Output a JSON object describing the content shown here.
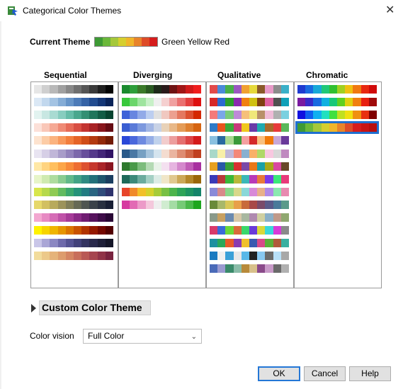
{
  "window": {
    "title": "Categorical Color Themes",
    "close_icon": "close-icon",
    "app_icon": "jmp-app-icon"
  },
  "current_theme": {
    "label": "Current Theme",
    "name": "Green Yellow Red",
    "colors": [
      "#3e9a35",
      "#6bb83a",
      "#a5c83a",
      "#d6cf2e",
      "#f0b52a",
      "#e8842a",
      "#de4b27",
      "#d61c1c"
    ]
  },
  "columns": [
    {
      "label": "Sequential",
      "themes": [
        [
          "#e6e6e6",
          "#cfcfcf",
          "#b8b8b8",
          "#a0a0a0",
          "#888888",
          "#6f6f6f",
          "#555555",
          "#3a3a3a",
          "#1f1f1f",
          "#050505"
        ],
        [
          "#dbe8f5",
          "#c2d8ee",
          "#a3c3e3",
          "#84acd6",
          "#6694c8",
          "#4c7bb8",
          "#3563a6",
          "#224c90",
          "#143777",
          "#0a2358"
        ],
        [
          "#e2f3f0",
          "#c8e7e2",
          "#a9dbd2",
          "#87cdbf",
          "#66bca8",
          "#4aa78e",
          "#338f73",
          "#20755b",
          "#125c45",
          "#074430"
        ],
        [
          "#fce0d8",
          "#f9c7b8",
          "#f5a995",
          "#ef8a75",
          "#e66b58",
          "#d84e42",
          "#c33431",
          "#a82225",
          "#88151c",
          "#650b13"
        ],
        [
          "#fde3cf",
          "#fccca6",
          "#fbb37f",
          "#f8995c",
          "#f27e3d",
          "#e56427",
          "#d04d18",
          "#b33a10",
          "#932a0a",
          "#721c05"
        ],
        [
          "#e8e4f1",
          "#d6cfe6",
          "#c0b6d8",
          "#a89cc9",
          "#9282bb",
          "#7c68ab",
          "#684f9b",
          "#55398a",
          "#432578",
          "#311364"
        ],
        [
          "#ffe8a6",
          "#ffd480",
          "#ffbf5e",
          "#fca548",
          "#f78a3a",
          "#ee6d32",
          "#dd5130",
          "#c6372d",
          "#aa2428",
          "#8a1520"
        ],
        [
          "#e7f5c8",
          "#cfeab0",
          "#aedc9e",
          "#89cc91",
          "#62b98a",
          "#43a386",
          "#2f8a82",
          "#22707a",
          "#1e566e",
          "#1a3e60"
        ],
        [
          "#d8e64c",
          "#b6d94c",
          "#8fcb54",
          "#62bb60",
          "#3ca86d",
          "#26937a",
          "#227c82",
          "#296582",
          "#2f4c7b",
          "#2e336c"
        ],
        [
          "#e6d86a",
          "#d2c060",
          "#b8aa5c",
          "#9c935a",
          "#807e58",
          "#666955",
          "#4f5551",
          "#3a424a",
          "#283040",
          "#181f34"
        ],
        [
          "#f3a8d0",
          "#e78ac3",
          "#d56cb6",
          "#bf52a8",
          "#a63b98",
          "#8b2a86",
          "#701d72",
          "#56135d",
          "#3e0c48",
          "#290634"
        ],
        [
          "#fff200",
          "#f7d400",
          "#efb500",
          "#e69500",
          "#da7400",
          "#c95300",
          "#b23400",
          "#951900",
          "#740800",
          "#520000"
        ],
        [
          "#c9c6e8",
          "#aaa6d6",
          "#8b87c2",
          "#6e6aab",
          "#555393",
          "#42417a",
          "#343461",
          "#29294b",
          "#1e1f38",
          "#141527"
        ],
        [
          "#f2dc9c",
          "#ecc98a",
          "#e5b37a",
          "#dd9c6d",
          "#d48563",
          "#c86e5b",
          "#b95955",
          "#a6454f",
          "#903348",
          "#78233f"
        ]
      ]
    },
    {
      "label": "Diverging",
      "themes": [
        [
          "#1a8a2e",
          "#2e9e3a",
          "#3b7a2a",
          "#2a5a22",
          "#1e2a1a",
          "#2a1a1a",
          "#6e1212",
          "#a01616",
          "#d01a1a",
          "#f01e1e"
        ],
        [
          "#38c83c",
          "#6ad66a",
          "#9ee49e",
          "#c8f0c8",
          "#efefef",
          "#f5d0d0",
          "#f0a0a0",
          "#ea7070",
          "#e44040",
          "#de1010"
        ],
        [
          "#3e62d8",
          "#6886e0",
          "#92aae8",
          "#bccef0",
          "#e0e0e0",
          "#f0c8c0",
          "#eca090",
          "#e47860",
          "#dc5030",
          "#d42800"
        ],
        [
          "#3a5ed2",
          "#5a7ad8",
          "#7c98de",
          "#a2b6e4",
          "#c8d2e6",
          "#e8d2b8",
          "#e8b888",
          "#e49c58",
          "#de8030",
          "#d66410"
        ],
        [
          "#2a48d8",
          "#4a68dc",
          "#6e8ae0",
          "#96aee6",
          "#c0d2ec",
          "#f2cccc",
          "#ec9e9e",
          "#e47070",
          "#dc4444",
          "#d41a1a"
        ],
        [
          "#2a5a8a",
          "#4a78a4",
          "#76a0c2",
          "#a6c4dc",
          "#d4e4ee",
          "#f4dcd0",
          "#eab4a0",
          "#de8c72",
          "#d06646",
          "#c04020"
        ],
        [
          "#2e7a2e",
          "#4a9a4a",
          "#7cbc7c",
          "#b4dab4",
          "#e8f2e8",
          "#f4e0f0",
          "#e6b4e0",
          "#d488cc",
          "#c05cb6",
          "#a830a0"
        ],
        [
          "#1e6a5a",
          "#3c8a7a",
          "#6cac9e",
          "#a4d0c4",
          "#dcece6",
          "#f0e6c8",
          "#e0c890",
          "#cca858",
          "#b48628",
          "#9a6608"
        ],
        [
          "#e7452a",
          "#f08a2a",
          "#f2c02a",
          "#d4d22e",
          "#a6cc3a",
          "#78c044",
          "#4cb44c",
          "#2ea458",
          "#1e9462",
          "#14846a"
        ],
        [
          "#d63aa0",
          "#e26ab4",
          "#ec9ac8",
          "#f4c8dc",
          "#eeeeee",
          "#d0ecd0",
          "#a4dca4",
          "#76ca76",
          "#4ab84a",
          "#1ea61e"
        ]
      ]
    },
    {
      "label": "Qualitative",
      "themes": [
        [
          "#e24a4a",
          "#4a8ad8",
          "#48b048",
          "#9a58c0",
          "#f0a030",
          "#e6d83a",
          "#8a5a2a",
          "#e89ac8",
          "#8c8c8c",
          "#3ab0c8"
        ],
        [
          "#d62828",
          "#2a6ad0",
          "#2aa02a",
          "#8a2ab0",
          "#f08010",
          "#d0c010",
          "#804010",
          "#e060a0",
          "#505050",
          "#10a0b8"
        ],
        [
          "#f47a7a",
          "#7aa6e8",
          "#7acc7a",
          "#be8ad8",
          "#f6c07a",
          "#f0e87a",
          "#b8906a",
          "#f0bcd8",
          "#b0b0b0",
          "#7ad0e0"
        ],
        [
          "#2e7ac8",
          "#e8541e",
          "#3aaa3a",
          "#c83a7a",
          "#f0c81e",
          "#6a3aa8",
          "#1eaab0",
          "#a86a2a",
          "#e83a3a",
          "#5ab85a"
        ],
        [
          "#8ac0e0",
          "#2a6aa0",
          "#a8d890",
          "#3a9a3a",
          "#f4a0a0",
          "#d42a2a",
          "#f8c080",
          "#f07a0a",
          "#c8a8d8",
          "#6a3a9a"
        ],
        [
          "#a8d8c8",
          "#f8f0a8",
          "#c0b8d8",
          "#f48878",
          "#88b0d0",
          "#f8b068",
          "#b0d868",
          "#f8c8e0",
          "#d8d8d8",
          "#c08ac0"
        ],
        [
          "#e6a020",
          "#2a58a8",
          "#38a038",
          "#d83030",
          "#7a48a8",
          "#e87818",
          "#18a0a8",
          "#a8a818",
          "#d848a0",
          "#684828"
        ],
        [
          "#3a3ab8",
          "#b83a3a",
          "#3ab83a",
          "#b8b83a",
          "#3ab8b8",
          "#b83ab8",
          "#e87a3a",
          "#7a3ae8",
          "#3ae87a",
          "#e83a7a"
        ],
        [
          "#8a8ad8",
          "#d88a8a",
          "#8ad88a",
          "#d8d88a",
          "#8ad8d8",
          "#d88ad8",
          "#e8b08a",
          "#b08ae8",
          "#8ae8b0",
          "#e88ab0"
        ],
        [
          "#6a8a3a",
          "#a8b86a",
          "#d8c858",
          "#e8a04a",
          "#c86a3a",
          "#a84848",
          "#7a4a6a",
          "#5a5a8a",
          "#4a7a9a",
          "#5a9a8a"
        ],
        [
          "#8a9a8a",
          "#c8a060",
          "#6a8ab0",
          "#d8c8a8",
          "#a8b8a0",
          "#b08ab0",
          "#d0d0a0",
          "#8ab0c8",
          "#c09a8a",
          "#90a870"
        ],
        [
          "#d83a6a",
          "#3a6ad8",
          "#6ad83a",
          "#d86a3a",
          "#3ad86a",
          "#6a3ad8",
          "#d8d83a",
          "#3ad8d8",
          "#d83ad8",
          "#8a8a8a"
        ],
        [
          "#1e90a0",
          "#2aa85a",
          "#e85a2a",
          "#8a3ab0",
          "#f0c02a",
          "#3a5ab0",
          "#d84a8a",
          "#5ab03a",
          "#b05a3a",
          "#3ab0a0"
        ],
        [
          "#1a7ac0",
          "#f0f0f0",
          "#3aa0d8",
          "#e8e8e8",
          "#58b8e8",
          "#202020",
          "#88c8f0",
          "#6a6a6a",
          "#b8e0f8",
          "#a8a8a8"
        ],
        [
          "#4a6ab8",
          "#9a9ad0",
          "#3a8a6a",
          "#8abca8",
          "#b88a3a",
          "#d8c08a",
          "#8a4a8a",
          "#c89ac8",
          "#6a6a6a",
          "#b0b0b0"
        ]
      ]
    },
    {
      "label": "Chromatic",
      "themes": [
        [
          "#1e3ad0",
          "#1a6ae0",
          "#18a8d8",
          "#20c878",
          "#30c030",
          "#a0d020",
          "#f0c010",
          "#f07810",
          "#e82810",
          "#d00a0a"
        ],
        [
          "#7a1aa0",
          "#3a2ac8",
          "#1a6ae0",
          "#10b0e0",
          "#18c878",
          "#60d020",
          "#e0d010",
          "#f08010",
          "#e82010",
          "#a00a0a"
        ],
        [
          "#1010e0",
          "#1060f0",
          "#10b0f0",
          "#20e0c0",
          "#40e040",
          "#c0e020",
          "#f0e010",
          "#f09010",
          "#e83010",
          "#800000"
        ],
        [
          "#3e9a35",
          "#6bb83a",
          "#a5c83a",
          "#d6cf2e",
          "#f0b52a",
          "#e8842a",
          "#de4b27",
          "#d61c1c",
          "#c81414",
          "#b80e0e"
        ]
      ],
      "selected_index": 3
    }
  ],
  "custom": {
    "label": "Custom Color Theme"
  },
  "vision": {
    "label": "Color vision",
    "value": "Full Color"
  },
  "buttons": {
    "ok": "OK",
    "cancel": "Cancel",
    "help": "Help"
  }
}
